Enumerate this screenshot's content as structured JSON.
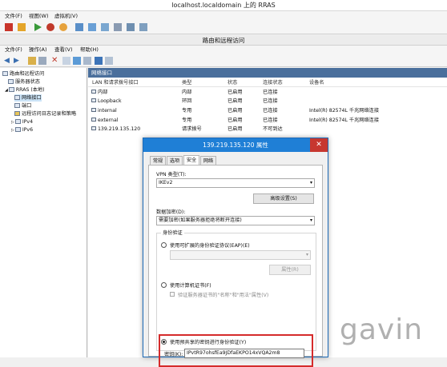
{
  "vm": {
    "title": "localhost.localdomain 上的 RRAS",
    "menu": [
      "文件(F)",
      "视图(W)",
      "虚拟机(V)"
    ]
  },
  "mmc": {
    "title": "路由和远程访问",
    "menu": [
      "文件(F)",
      "操作(A)",
      "查看(V)",
      "帮助(H)"
    ]
  },
  "tree": {
    "items": [
      {
        "label": "路由和远程访问"
      },
      {
        "label": "服务器状态"
      },
      {
        "label": "RRAS (本地)"
      },
      {
        "label": "网络接口"
      },
      {
        "label": "端口"
      },
      {
        "label": "远程访问日志记录和策略"
      },
      {
        "label": "IPv4"
      },
      {
        "label": "IPv6"
      }
    ]
  },
  "list": {
    "pane_title": "网络接口",
    "columns": [
      "LAN 和请求拨号接口",
      "类型",
      "状态",
      "连接状态",
      "设备名"
    ],
    "rows": [
      {
        "name": "内部",
        "type": "内部",
        "status": "已启用",
        "conn": "已连接",
        "device": ""
      },
      {
        "name": "Loopback",
        "type": "环回",
        "status": "已启用",
        "conn": "已连接",
        "device": ""
      },
      {
        "name": "internal",
        "type": "专用",
        "status": "已启用",
        "conn": "已连接",
        "device": "Intel(R) 82574L 千兆网络连接"
      },
      {
        "name": "external",
        "type": "专用",
        "status": "已启用",
        "conn": "已连接",
        "device": "Intel(R) 82574L 千兆网络连接"
      },
      {
        "name": "139.219.135.120",
        "type": "请求拨号",
        "status": "已启用",
        "conn": "不可到达",
        "device": ""
      }
    ]
  },
  "dialog": {
    "title": "139.219.135.120 属性",
    "close": "✕",
    "tabs": [
      "常规",
      "选项",
      "安全",
      "网络"
    ],
    "vpn_type_label": "VPN 类型(T):",
    "vpn_type_value": "IKEv2",
    "advanced_button": "高级设置(S)",
    "encryption_label": "数据加密(D):",
    "encryption_value": "需要加密(如果服务器拒绝将断开连接)",
    "auth_group_label": "身份验证",
    "eap_option": "使用可扩展的身份验证协议(EAP)(E)",
    "eap_props_button": "属性(R)",
    "cert_option": "使用计算机证书(F)",
    "cert_check": "验证服务器证书的\"名称\"和\"用法\"属性(V)",
    "psk_option": "使用预共享的密钥进行身份验证(Y)",
    "key_label": "密钥(K):",
    "key_value": "IPvtR97ohsfEa9JDfaEKPO14xVQA2m8"
  },
  "watermark": "gavin"
}
